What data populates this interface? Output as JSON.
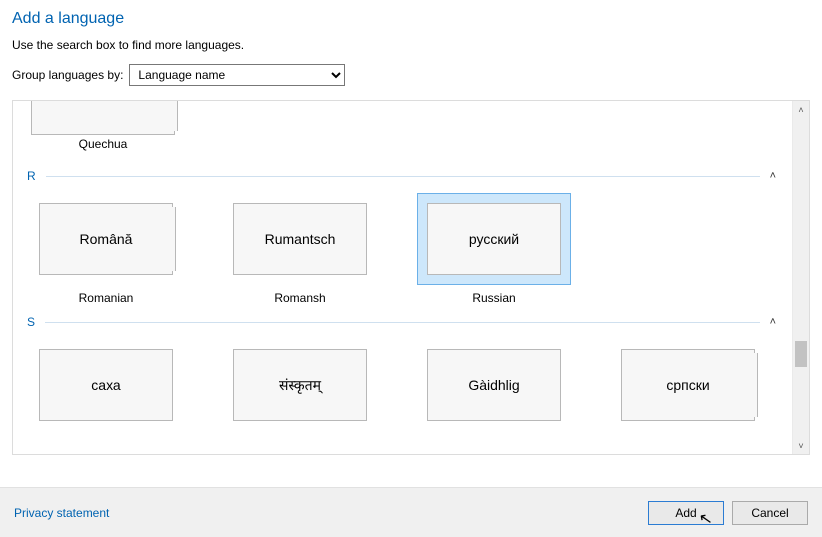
{
  "title": "Add a language",
  "hint": "Use the search box to find more languages.",
  "group_label": "Group languages by:",
  "group_select_value": "Language name",
  "partial_top": {
    "caption": "Quechua"
  },
  "sections": [
    {
      "letter": "R",
      "items": [
        {
          "native": "Română",
          "english": "Romanian",
          "stack": true,
          "selected": false
        },
        {
          "native": "Rumantsch",
          "english": "Romansh",
          "stack": false,
          "selected": false
        },
        {
          "native": "русский",
          "english": "Russian",
          "stack": false,
          "selected": true
        }
      ]
    },
    {
      "letter": "S",
      "items": [
        {
          "native": "саха",
          "english": "",
          "stack": false
        },
        {
          "native": "संस्कृतम्",
          "english": "",
          "stack": false
        },
        {
          "native": "Gàidhlig",
          "english": "",
          "stack": false
        },
        {
          "native": "српски",
          "english": "",
          "stack": true
        }
      ]
    }
  ],
  "footer": {
    "privacy": "Privacy statement",
    "add": "Add",
    "cancel": "Cancel"
  }
}
